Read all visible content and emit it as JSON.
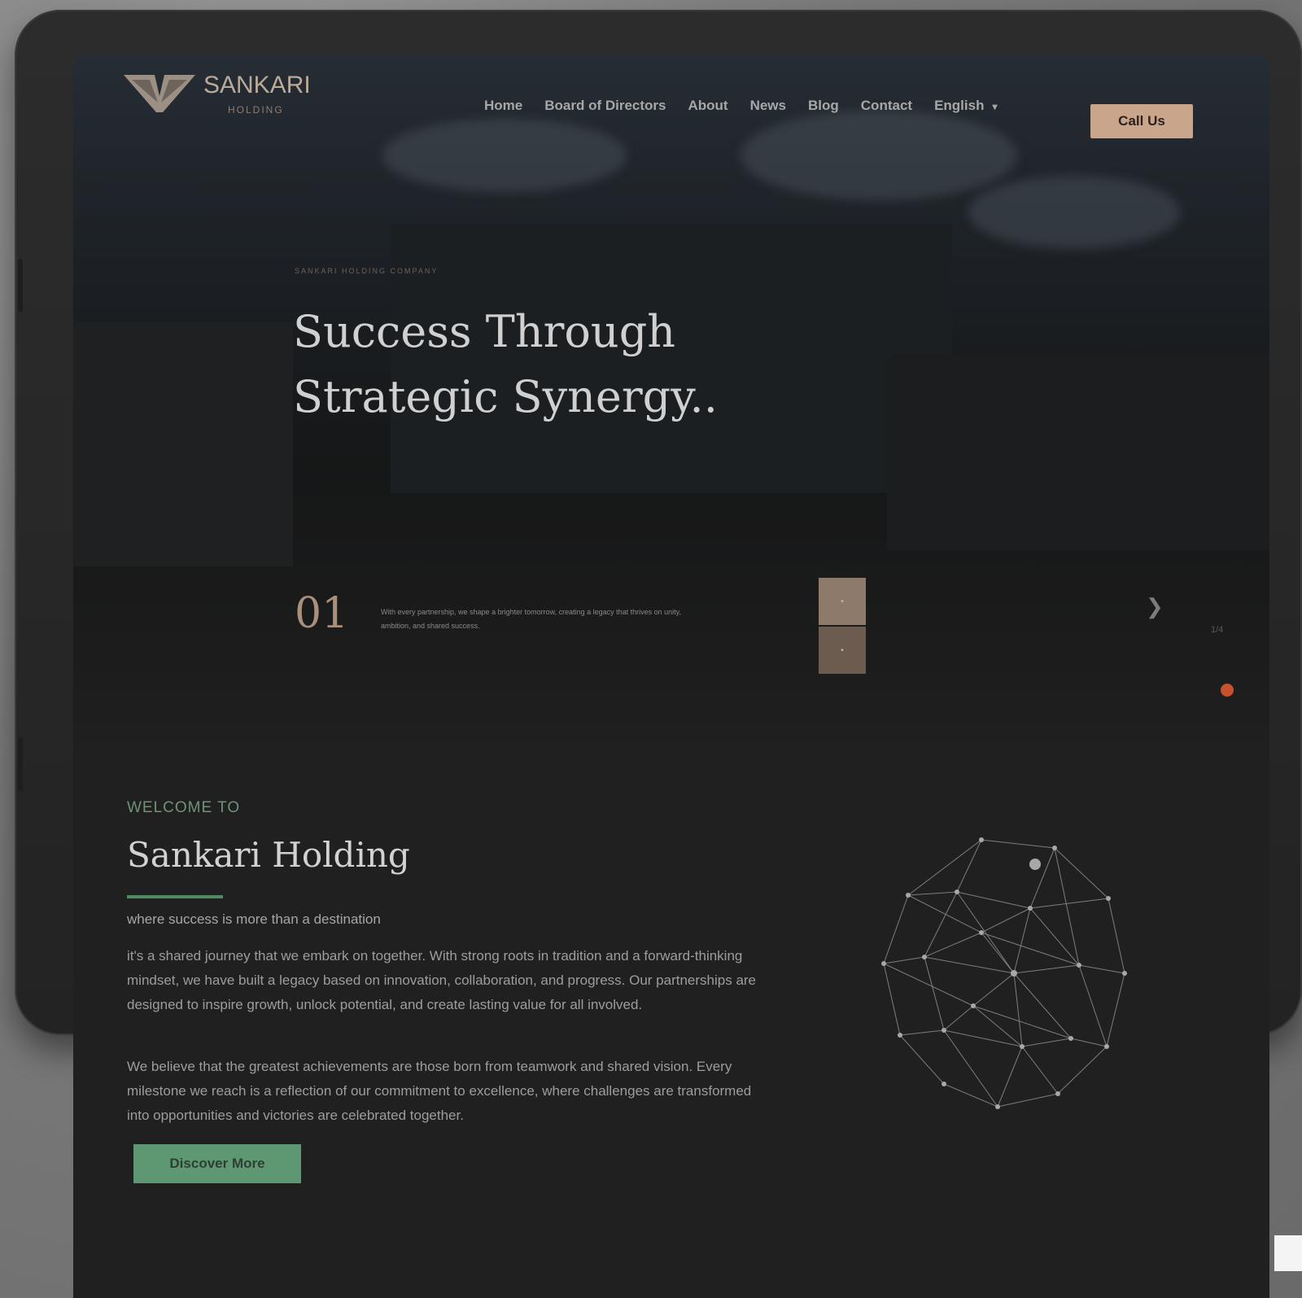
{
  "brand": {
    "name": "SANKARI",
    "subtitle": "HOLDING"
  },
  "nav": {
    "items": [
      {
        "label": "Home"
      },
      {
        "label": "Board of Directors"
      },
      {
        "label": "About"
      },
      {
        "label": "News"
      },
      {
        "label": "Blog"
      },
      {
        "label": "Contact"
      }
    ],
    "language": "English",
    "call_label": "Call Us"
  },
  "hero": {
    "eyebrow": "SANKARI HOLDING COMPANY",
    "title_line1": "Success Through",
    "title_line2": "Strategic Synergy..",
    "slide_number": "01",
    "slide_text": "With every partnership, we shape a brighter tomorrow, creating a legacy that thrives on unity, ambition, and shared success.",
    "counter": "1/4"
  },
  "welcome": {
    "eyebrow": "WELCOME TO",
    "title": "Sankari Holding",
    "tagline": "where success is more than a destination",
    "paragraph1": "it's a shared journey that we embark on together. With strong roots in tradition and a forward-thinking mindset, we have built a legacy based on innovation, collaboration, and progress. Our partnerships are designed to inspire growth, unlock potential, and create lasting value for all involved.",
    "paragraph2": "We believe that the greatest achievements are those born from teamwork and shared vision. Every milestone we reach is a reflection of our commitment to excellence, where challenges are transformed into opportunities and victories are celebrated together.",
    "cta_label": "Discover More"
  },
  "colors": {
    "accent_copper": "#c9a58c",
    "accent_green": "#5e9872",
    "dot_orange": "#c8522e"
  }
}
